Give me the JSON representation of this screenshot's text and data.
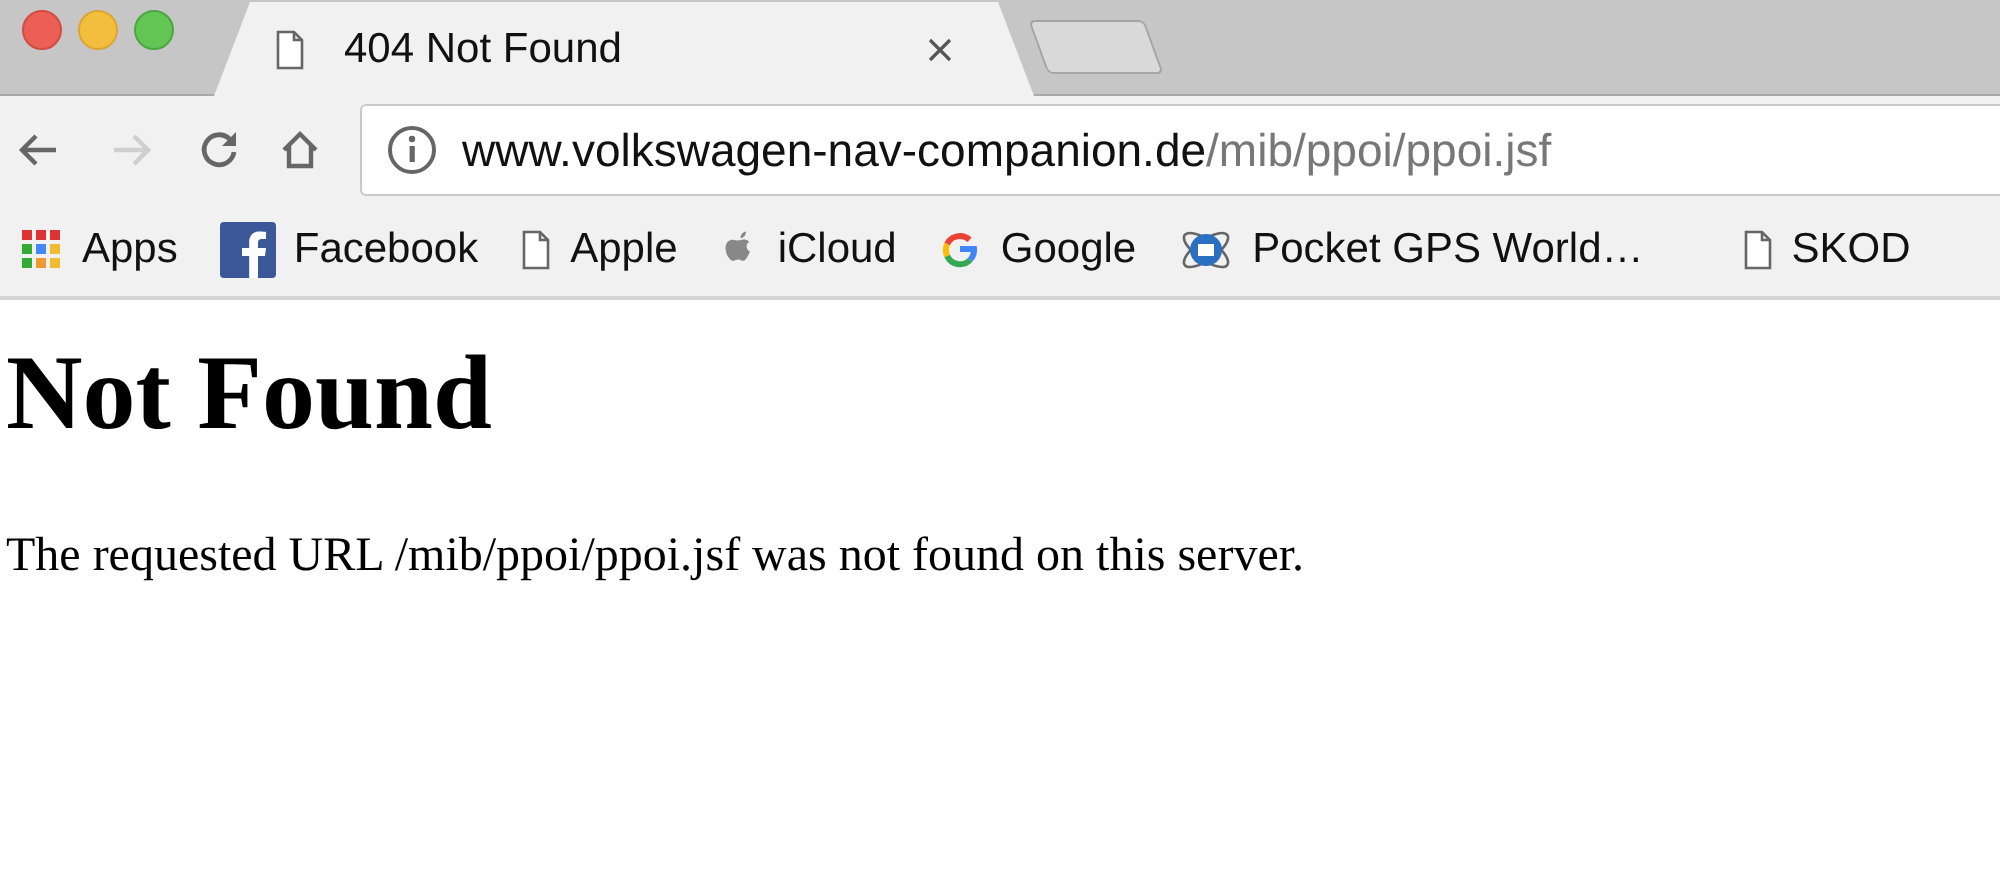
{
  "tab": {
    "title": "404 Not Found",
    "selected": true
  },
  "toolbar": {
    "buttons": [
      {
        "kind": "back",
        "disabled": false
      },
      {
        "kind": "forward",
        "disabled": true
      },
      {
        "kind": "reload",
        "disabled": false
      },
      {
        "kind": "home",
        "disabled": false
      }
    ]
  },
  "address_bar": {
    "host": "www.volkswagen-nav-companion.de",
    "path": "/mib/ppoi/ppoi.jsf"
  },
  "bookmarks": [
    {
      "label": "Apps",
      "kind": "apps"
    },
    {
      "label": "Facebook",
      "kind": "facebook"
    },
    {
      "label": "Apple",
      "kind": "page"
    },
    {
      "label": "iCloud",
      "kind": "apple"
    },
    {
      "label": "Google",
      "kind": "google"
    },
    {
      "label": "Pocket GPS World…",
      "kind": "globe"
    },
    {
      "label": "SKOD",
      "kind": "page"
    }
  ],
  "page": {
    "heading": "Not Found",
    "message": "The requested URL /mib/ppoi/ppoi.jsf was not found on this server."
  }
}
